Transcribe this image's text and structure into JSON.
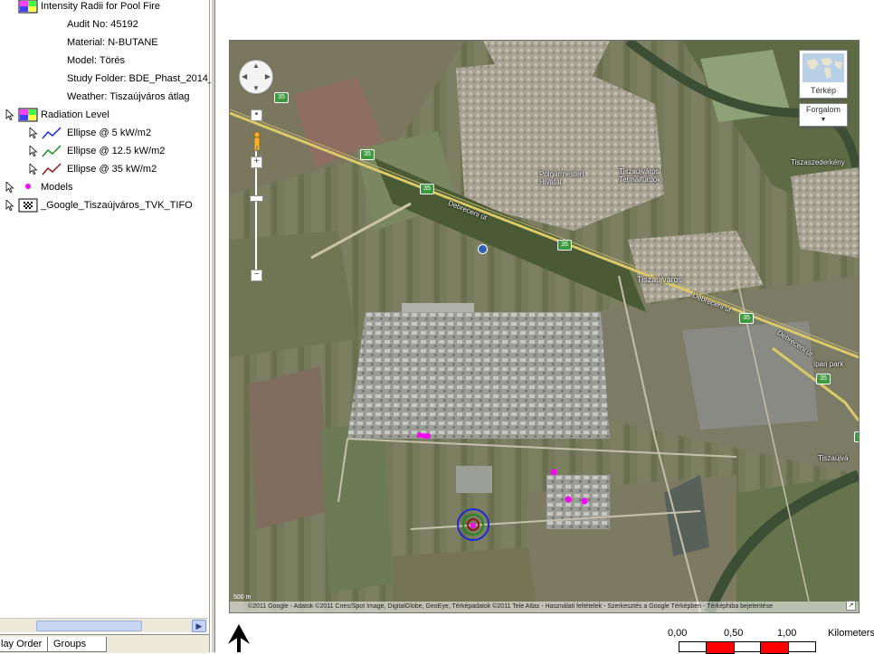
{
  "legend": {
    "intensity_group": "Intensity Radii for Pool Fire",
    "audit_no": "Audit No: 45192",
    "material": "Material: N-BUTANE",
    "model": "Model: Törés",
    "study_folder": "Study Folder: BDE_Phast_2014_",
    "weather": "Weather: Tiszaújváros átlag",
    "radiation_level": "Radiation Level",
    "ellipses": [
      {
        "label": "Ellipse @ 5 kW/m2",
        "color": "#1a2ad6"
      },
      {
        "label": "Ellipse @ 12.5 kW/m2",
        "color": "#1e8a1e"
      },
      {
        "label": "Ellipse @ 35 kW/m2",
        "color": "#8b1a1a"
      }
    ],
    "models": "Models",
    "models_color": "#ff00ff",
    "google_layer": "_Google_Tiszaújváros_TVK_TIFO"
  },
  "tabs": {
    "display_order": "lay Order",
    "groups": "Groups"
  },
  "map": {
    "map_type": "Térkép",
    "overlay": "Forgalom",
    "labels": {
      "polgarmesteri": "Polgármesteri\nHivatal",
      "termalfurdo": "Tiszaújvárosi\nTermálfürdők",
      "tiszaujvaros": "Tiszaújváros",
      "tiszaszederkeny": "Tiszaszederkény",
      "ipari_park": "Ipari park",
      "tiszaujvaros_edge": "Tiszaújvá",
      "debreceni_ut1": "Debreceni út",
      "debreceni_ut2": "Debreceni út",
      "debreceni_ut3": "Debreceni út"
    },
    "shields": [
      "35",
      "35",
      "35",
      "35",
      "35",
      "35",
      "35",
      "35"
    ],
    "scale_label": "500 m",
    "copyright": "©2011 Google - Adatok ©2011 Cnes/Spot Image, DigitalGlobe, GeoEye, Térképadatok ©2011 Tele Atlas - Használati feltételek - Szerkesztés a Google Térképben - Térképhiba bejelentése"
  },
  "scalebar": {
    "ticks": [
      "0,00",
      "0,50",
      "1,00"
    ],
    "units": "Kilometers"
  }
}
